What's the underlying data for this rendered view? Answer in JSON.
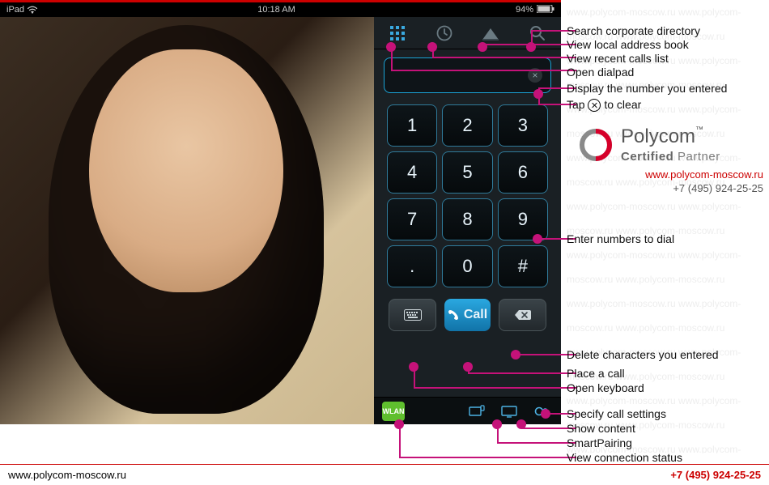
{
  "status": {
    "device": "iPad",
    "time": "10:18 AM",
    "battery": "94%"
  },
  "tabs": {
    "dialpad": "dialpad",
    "recents": "recents",
    "contacts": "contacts",
    "search": "search"
  },
  "display": {
    "value": "",
    "clear_label": "×"
  },
  "keys": [
    "1",
    "2",
    "3",
    "4",
    "5",
    "6",
    "7",
    "8",
    "9",
    ".",
    "0",
    "#"
  ],
  "actions": {
    "keyboard_label": "⌨",
    "call_label": "Call",
    "delete_label": "⌫"
  },
  "bottom": {
    "wlan": "WLAN"
  },
  "annotations": {
    "search": "Search corporate directory",
    "contacts": "View local address book",
    "recents": "View recent calls list",
    "dialpad": "Open dialpad",
    "display1": "Display the number you entered",
    "display2_a": "Tap ",
    "display2_b": " to clear",
    "enter": "Enter numbers to dial",
    "delete": "Delete characters you entered",
    "place": "Place a call",
    "keyboard": "Open keyboard",
    "settings": "Specify call settings",
    "content": "Show content",
    "pairing": "SmartPairing",
    "connstatus": "View connection status"
  },
  "partner": {
    "brand": "Polycom",
    "tm": "™",
    "cert_strong": "Certified",
    "cert_rest": " Partner",
    "link": "www.polycom-moscow.ru",
    "phone": "+7 (495) 924-25-25"
  },
  "footer": {
    "left": "www.polycom-moscow.ru",
    "right": "+7 (495) 924-25-25"
  },
  "watermark": "www.polycom-moscow.ru "
}
